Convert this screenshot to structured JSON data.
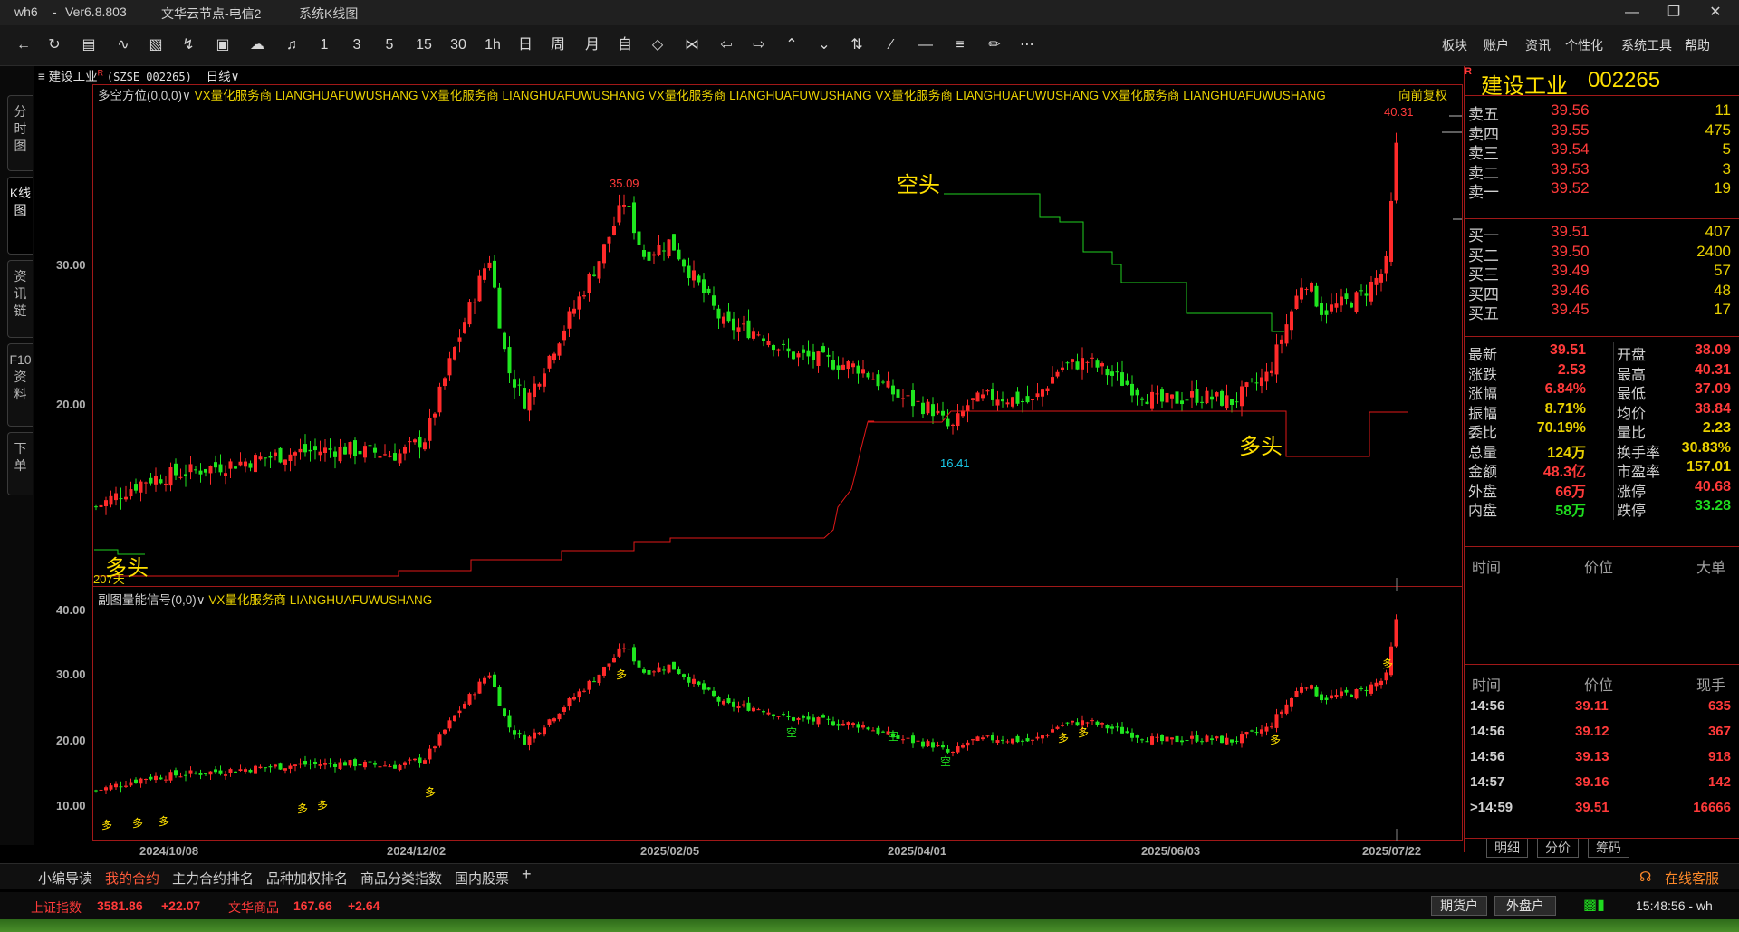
{
  "app": {
    "name": "wh6",
    "sep": "-",
    "version": "Ver6.8.803",
    "server": "文华云节点-电信2",
    "view": "系统K线图"
  },
  "toolbar": {
    "icons": [
      "back-icon",
      "refresh-icon",
      "table-icon",
      "line-chart-icon",
      "candlestick-icon",
      "tick-chart-icon",
      "kline-box-icon",
      "cloud-icon",
      "bell-icon"
    ],
    "periods": [
      "1",
      "3",
      "5",
      "15",
      "30",
      "1h",
      "日",
      "周",
      "月",
      "自"
    ],
    "menus": [
      "板块",
      "账户",
      "资讯",
      "个性化",
      "系统工具",
      "帮助"
    ]
  },
  "sidetabs": [
    "分时图",
    "K线图",
    "资讯链",
    "F10资料",
    "下单"
  ],
  "chart": {
    "instrument": "建设工业",
    "code": "(SZSE 002265)",
    "period": "日线∨",
    "adjust": "向前复权",
    "main_indicator": "多空方位(0,0,0)∨",
    "ind_tag": "VX量化服务商",
    "ind_name": "LIANGHUAFUWUSHANG",
    "sub_indicator": "副图量能信号(0,0)∨",
    "labels": {
      "kongtou": "空头",
      "duotou_mid": "多头",
      "duotou_left": "多头",
      "days": "207天",
      "hi_label": "35.09",
      "lo_label": "16.41",
      "top_label": "40.31",
      "duo": "多",
      "kong": "空"
    }
  },
  "chart_data": {
    "type": "candlestick",
    "main_y_ticks": [
      "30.00",
      "20.00"
    ],
    "sub_y_ticks": [
      "40.00",
      "30.00",
      "20.00",
      "10.00"
    ],
    "x_ticks": [
      "2024/10/08",
      "2024/12/02",
      "2025/02/05",
      "2025/04/01",
      "2025/06/03",
      "2025/07/22"
    ],
    "annotations": {
      "peak": 35.09,
      "trough": 16.41,
      "latest_high": 40.31
    }
  },
  "quote": {
    "name": "建设工业",
    "code": "002265",
    "asks": [
      {
        "label": "卖五",
        "price": "39.56",
        "vol": "11"
      },
      {
        "label": "卖四",
        "price": "39.55",
        "vol": "475"
      },
      {
        "label": "卖三",
        "price": "39.54",
        "vol": "5"
      },
      {
        "label": "卖二",
        "price": "39.53",
        "vol": "3"
      },
      {
        "label": "卖一",
        "price": "39.52",
        "vol": "19"
      }
    ],
    "bids": [
      {
        "label": "买一",
        "price": "39.51",
        "vol": "407"
      },
      {
        "label": "买二",
        "price": "39.50",
        "vol": "2400"
      },
      {
        "label": "买三",
        "price": "39.49",
        "vol": "57"
      },
      {
        "label": "买四",
        "price": "39.46",
        "vol": "48"
      },
      {
        "label": "买五",
        "price": "39.45",
        "vol": "17"
      }
    ],
    "stats": [
      {
        "l1": "最新",
        "v1": "39.51",
        "c1": "#ff3a3a",
        "l2": "开盘",
        "v2": "38.09",
        "c2": "#ff3a3a"
      },
      {
        "l1": "涨跌",
        "v1": "2.53",
        "c1": "#ff3a3a",
        "l2": "最高",
        "v2": "40.31",
        "c2": "#ff3a3a"
      },
      {
        "l1": "涨幅",
        "v1": "6.84%",
        "c1": "#ff3a3a",
        "l2": "最低",
        "v2": "37.09",
        "c2": "#ff3a3a"
      },
      {
        "l1": "振幅",
        "v1": "8.71%",
        "c1": "#e8d000",
        "l2": "均价",
        "v2": "38.84",
        "c2": "#ff3a3a"
      },
      {
        "l1": "委比",
        "v1": "70.19%",
        "c1": "#e8d000",
        "l2": "量比",
        "v2": "2.23",
        "c2": "#e8d000"
      },
      {
        "l1": "总量",
        "v1": "124万",
        "c1": "#e8d000",
        "l2": "换手率",
        "v2": "30.83%",
        "c2": "#e8d000"
      },
      {
        "l1": "金额",
        "v1": "48.3亿",
        "c1": "#ff3a3a",
        "l2": "市盈率",
        "v2": "157.01",
        "c2": "#e8d000"
      },
      {
        "l1": "外盘",
        "v1": "66万",
        "c1": "#ff3a3a",
        "l2": "涨停",
        "v2": "40.68",
        "c2": "#ff3a3a"
      },
      {
        "l1": "内盘",
        "v1": "58万",
        "c1": "#1fdc1f",
        "l2": "跌停",
        "v2": "33.28",
        "c2": "#1fdc1f"
      }
    ],
    "hdr1": [
      "时间",
      "价位",
      "大单"
    ],
    "hdr2": [
      "时间",
      "价位",
      "现手"
    ],
    "ticks": [
      {
        "t": "14:56",
        "p": "39.11",
        "v": "635"
      },
      {
        "t": "14:56",
        "p": "39.12",
        "v": "367"
      },
      {
        "t": "14:56",
        "p": "39.13",
        "v": "918"
      },
      {
        "t": "14:57",
        "p": "39.16",
        "v": "142"
      },
      {
        "t": ">14:59",
        "p": "39.51",
        "v": "16666"
      }
    ],
    "tabs": [
      "明细",
      "分价",
      "筹码"
    ]
  },
  "bottom_tabs": [
    "小编导读",
    "我的合约",
    "主力合约排名",
    "品种加权排名",
    "商品分类指数",
    "国内股票",
    "+"
  ],
  "service": "在线客服",
  "status": {
    "idx1_name": "上证指数",
    "idx1_val": "3581.86",
    "idx1_chg": "+22.07",
    "idx2_name": "文华商品",
    "idx2_val": "167.66",
    "idx2_chg": "+2.64",
    "btn1": "期货户",
    "btn2": "外盘户",
    "time": "15:48:56 - wh"
  }
}
